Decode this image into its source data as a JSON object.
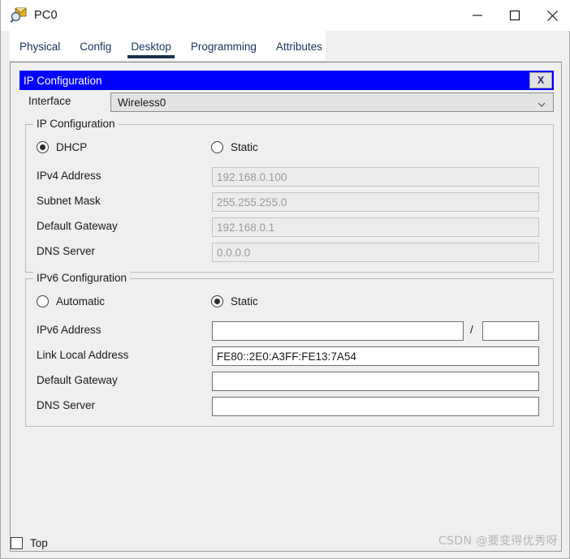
{
  "window": {
    "title": "PC0",
    "icon": "pc-inspect-icon",
    "controls": {
      "minimize": "minimize-icon",
      "maximize": "maximize-icon",
      "close": "close-icon"
    }
  },
  "tabs": [
    {
      "label": "Physical",
      "active": false
    },
    {
      "label": "Config",
      "active": false
    },
    {
      "label": "Desktop",
      "active": true
    },
    {
      "label": "Programming",
      "active": false
    },
    {
      "label": "Attributes",
      "active": false
    }
  ],
  "app": {
    "title": "IP Configuration",
    "close_label": "X",
    "titlebar_color": "#0000ff",
    "interface": {
      "label": "Interface",
      "value": "Wireless0",
      "arrow": "chevron-down-icon"
    },
    "ipv4": {
      "group_title": "IP Configuration",
      "mode": {
        "dhcp_label": "DHCP",
        "static_label": "Static",
        "selected": "dhcp"
      },
      "fields": [
        {
          "label": "IPv4 Address",
          "value": "192.168.0.100",
          "disabled": true
        },
        {
          "label": "Subnet Mask",
          "value": "255.255.255.0",
          "disabled": true
        },
        {
          "label": "Default Gateway",
          "value": "192.168.0.1",
          "disabled": true
        },
        {
          "label": "DNS Server",
          "value": "0.0.0.0",
          "disabled": true
        }
      ]
    },
    "ipv6": {
      "group_title": "IPv6 Configuration",
      "mode": {
        "automatic_label": "Automatic",
        "static_label": "Static",
        "selected": "static"
      },
      "address": {
        "label": "IPv6 Address",
        "value": "",
        "separator": "/",
        "prefix_value": ""
      },
      "fields": [
        {
          "label": "Link Local Address",
          "value": "FE80::2E0:A3FF:FE13:7A54",
          "disabled": false
        },
        {
          "label": "Default Gateway",
          "value": "",
          "disabled": false
        },
        {
          "label": "DNS Server",
          "value": "",
          "disabled": false
        }
      ]
    }
  },
  "footer": {
    "top_checkbox_label": "Top",
    "top_checked": false
  },
  "watermark": "CSDN @要变得优秀呀"
}
